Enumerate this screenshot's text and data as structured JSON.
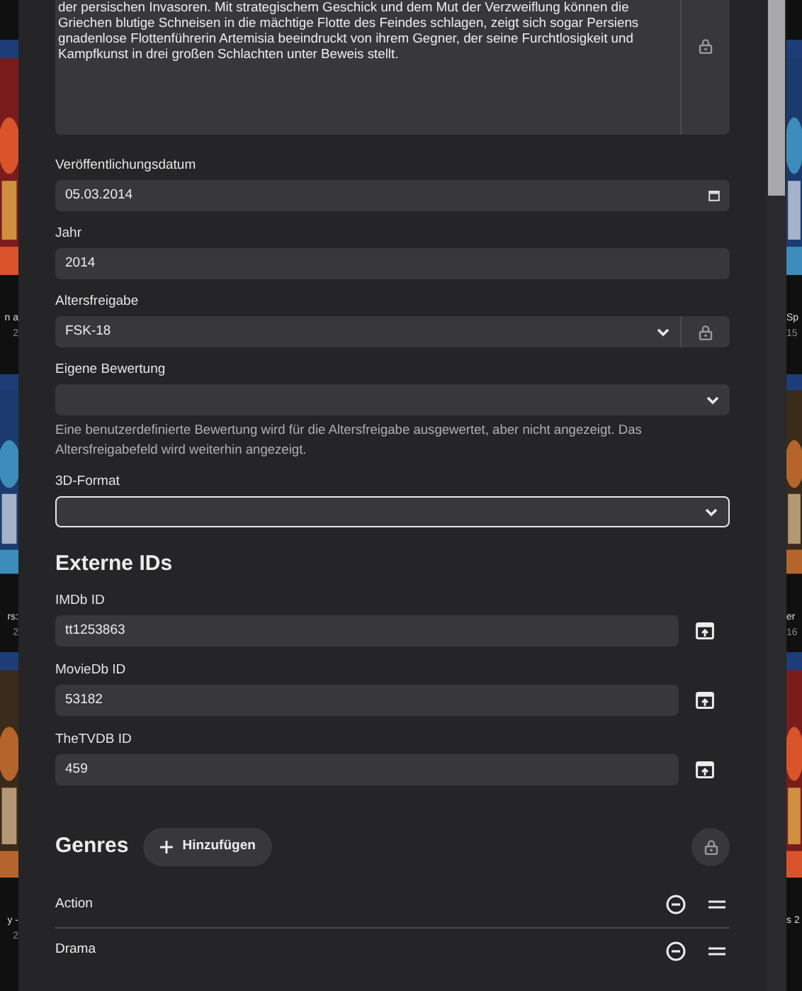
{
  "background": {
    "left_captions": [
      [
        "n a",
        "2"
      ],
      [
        "rs:",
        "2"
      ],
      [
        "y -",
        "2"
      ]
    ],
    "right_captions": [
      [
        "Sp",
        "15"
      ],
      [
        "er",
        "16"
      ],
      [
        "s 2"
      ]
    ]
  },
  "description": {
    "text": "der persischen Invasoren. Mit strategischem Geschick und dem Mut der Verzweiflung können die Griechen blutige Schneisen in die mächtige Flotte des Feindes schlagen, zeigt sich sogar Persiens gnadenlose Flottenführerin Artemisia beeindruckt von ihrem Gegner, der seine Furchtlosigkeit und Kampfkunst in drei großen Schlachten unter Beweis stellt.",
    "lock": true
  },
  "fields": [
    {
      "kind": "date",
      "label": "Veröffentlichungsdatum",
      "value": "05.03.2014",
      "lock": false,
      "focused": false
    },
    {
      "kind": "text",
      "label": "Jahr",
      "value": "2014",
      "lock": false,
      "focused": false
    },
    {
      "kind": "select",
      "label": "Altersfreigabe",
      "value": "FSK-18",
      "lock": true,
      "focused": false
    },
    {
      "kind": "select",
      "label": "Eigene Bewertung",
      "help": "Eine benutzerdefinierte Bewertung wird für die Altersfreigabe ausgewertet, aber nicht angezeigt. Das Altersfreigabefeld wird weiterhin angezeigt.",
      "lock": false,
      "focused": false
    },
    {
      "kind": "select",
      "label": "3D-Format",
      "lock": false,
      "focused": true
    }
  ],
  "external_ids": {
    "title": "Externe IDs",
    "items": [
      {
        "label": "IMDb ID",
        "value": "tt1253863"
      },
      {
        "label": "MovieDb ID",
        "value": "53182"
      },
      {
        "label": "TheTVDB ID",
        "value": "459"
      }
    ]
  },
  "genres": {
    "title": "Genres",
    "add_button": "Hinzufügen",
    "items": [
      {
        "name": "Action"
      },
      {
        "name": "Drama"
      }
    ]
  }
}
